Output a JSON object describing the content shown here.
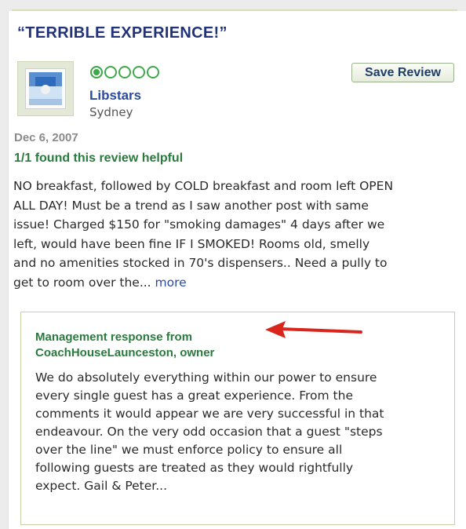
{
  "review": {
    "title": "“TERRIBLE EXPERIENCE!”",
    "rating": 1,
    "rating_max": 5,
    "reviewer": {
      "name": "Libstars",
      "location": "Sydney"
    },
    "save_label": "Save Review",
    "date": "Dec 6, 2007",
    "helpful": "1/1 found this review helpful",
    "body_lines": [
      "NO breakfast, followed by COLD breakfast and room left OPEN",
      "ALL DAY! Must be a trend as I saw another post with same",
      "issue! Charged $150 for \"smoking damages\" 4 days after we",
      "left, would have been fine IF I SMOKED! Rooms old, smelly",
      "and no amenities stocked in 70's dispensers.. Need a pully to",
      "get to room over the..."
    ],
    "more_label": "more"
  },
  "management": {
    "header_line1": "Management response from",
    "header_line2": "CoachHouseLaunceston, owner",
    "text_lines": [
      "We do absolutely everything within our power to ensure",
      "every single guest has a great experience. From the",
      "comments it would appear we are very successful in that",
      "endeavour. On the very odd occasion that a guest \"steps",
      "over the line\" we must enforce policy to ensure all",
      "following guests are treated as they would rightfully",
      "expect. Gail & Peter..."
    ]
  },
  "colors": {
    "title": "#22337a",
    "bubble": "#3ea84a",
    "helpful": "#2a7a3d",
    "link": "#2b4a9c",
    "arrow": "#d9261c"
  },
  "icons": {
    "avatar": "photo-avatar-icon",
    "rating": "bubble-rating-icon",
    "annotation": "red-arrow-icon"
  }
}
